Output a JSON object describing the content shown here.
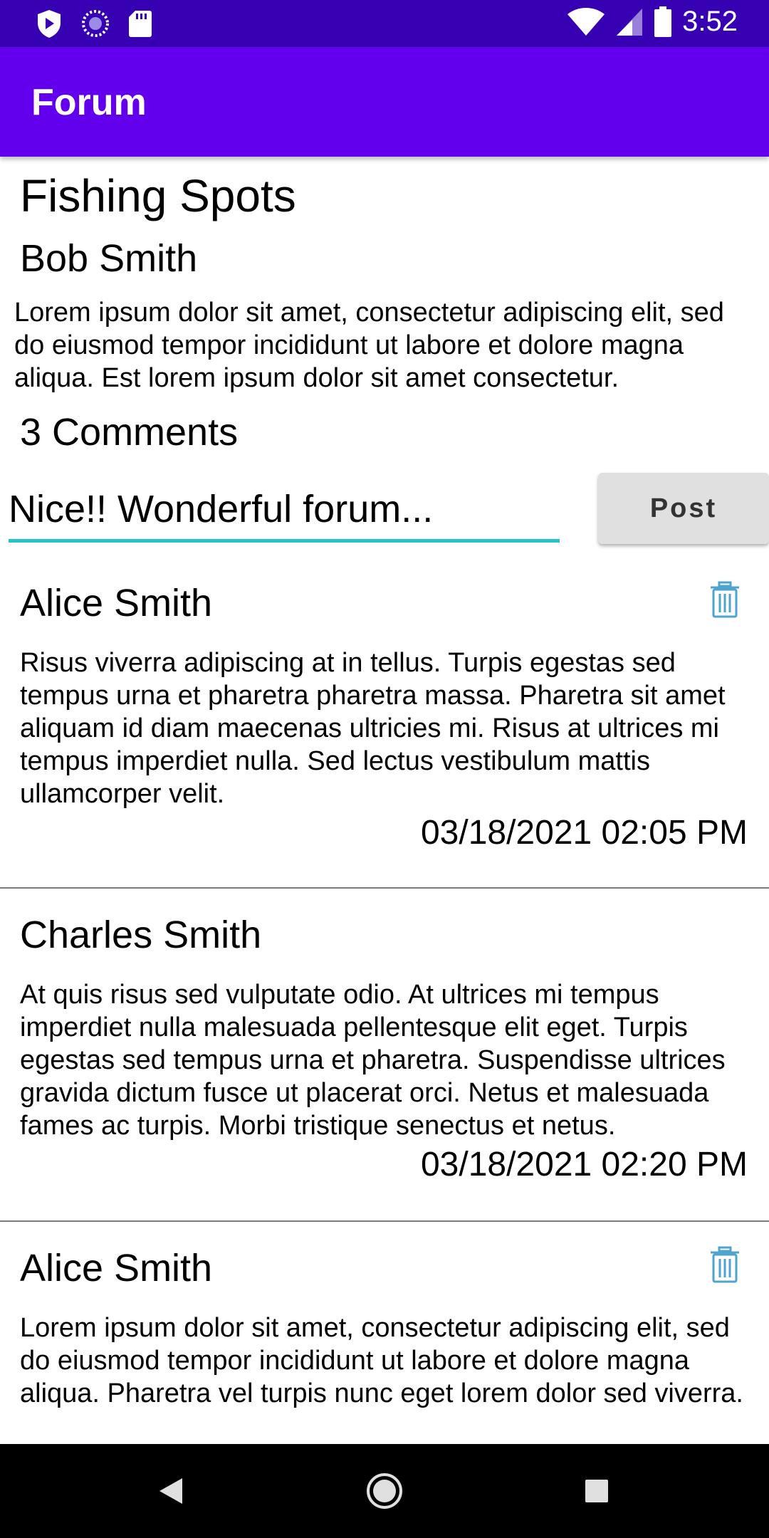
{
  "status_bar": {
    "time": "3:52",
    "left_icons": [
      "shield-icon",
      "loading-icon",
      "sd-card-icon"
    ],
    "right_icons": [
      "wifi-icon",
      "signal-icon",
      "battery-icon"
    ]
  },
  "app_bar": {
    "title": "Forum"
  },
  "post": {
    "title": "Fishing Spots",
    "author": "Bob Smith",
    "body": "Lorem ipsum dolor sit amet, consectetur adipiscing elit, sed do eiusmod tempor incididunt ut labore et dolore magna aliqua. Est lorem ipsum dolor sit amet consectetur."
  },
  "comments_header": "3 Comments",
  "comment_input": {
    "value": "Nice!! Wonderful forum..."
  },
  "post_button_label": "Post",
  "comments": [
    {
      "author": "Alice Smith",
      "body": "Risus viverra adipiscing at in tellus. Turpis egestas sed tempus urna et pharetra pharetra massa. Pharetra sit amet aliquam id diam maecenas ultricies mi. Risus at ultrices mi tempus imperdiet nulla. Sed lectus vestibulum mattis ullamcorper velit.",
      "time": "03/18/2021 02:05 PM",
      "deletable": true
    },
    {
      "author": "Charles Smith",
      "body": "At quis risus sed vulputate odio. At ultrices mi tempus imperdiet nulla malesuada pellentesque elit eget. Turpis egestas sed tempus urna et pharetra. Suspendisse ultrices gravida dictum fusce ut placerat orci. Netus et malesuada fames ac turpis. Morbi tristique senectus et netus.",
      "time": "03/18/2021 02:20 PM",
      "deletable": false
    },
    {
      "author": "Alice Smith",
      "body": "Lorem ipsum dolor sit amet, consectetur adipiscing elit, sed do eiusmod tempor incididunt ut labore et dolore magna aliqua. Pharetra vel turpis nunc eget lorem dolor sed viverra.",
      "time": "",
      "deletable": true
    }
  ],
  "colors": {
    "status_bar": "#3700b3",
    "app_bar": "#6200ee",
    "input_underline": "#26c6c6",
    "trash_icon": "#4fa3cf"
  },
  "nav_bar": {
    "icons": [
      "back-icon",
      "home-icon",
      "recents-icon"
    ]
  }
}
